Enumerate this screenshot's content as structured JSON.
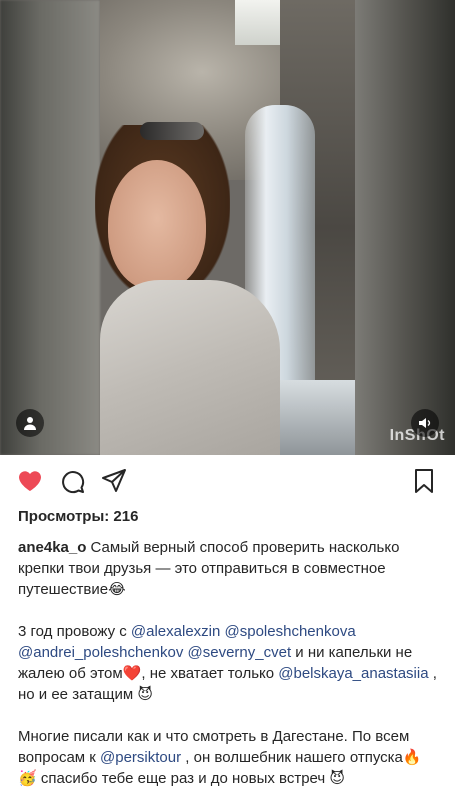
{
  "post": {
    "views_label": "Просмотры: 216",
    "watermark": "InShOt",
    "icons": {
      "like": "heart-icon",
      "comment": "comment-icon",
      "share": "share-icon",
      "save": "bookmark-icon",
      "tags": "user-tag-icon",
      "sound": "sound-icon"
    },
    "colors": {
      "like": "#ed4956",
      "mention": "#2e4a82"
    },
    "caption": {
      "username": "ane4ka_o",
      "p1_text": " Самый верный способ проверить насколько крепки твои друзья — это отправиться в совместное путешествие",
      "p1_emoji": "😂",
      "p2_a": "3 год провожу с ",
      "m1": "@alexalexzin",
      "m2": "@spoleshchenkova",
      "m3": "@andrei_poleshchenkov",
      "m4": "@severny_cvet",
      "p2_b": "  и ни капельки не жалею об этом",
      "p2_heart": "❤️",
      "p2_c": ", не хватает только ",
      "m5": "@belskaya_anastasiia",
      "p2_d": " , но и ее затащим ",
      "p2_devil": "😈",
      "p3_a": "Многие писали как и что смотреть в Дагестане. По всем вопросам к ",
      "m6": "@persiktour",
      "p3_b": " , он волшебник нашего отпуска",
      "p3_fire": "🔥",
      "p3_face": "🥳",
      "p3_c": " спасибо тебе еще раз и до новых встреч ",
      "p3_devil": "😈"
    }
  }
}
